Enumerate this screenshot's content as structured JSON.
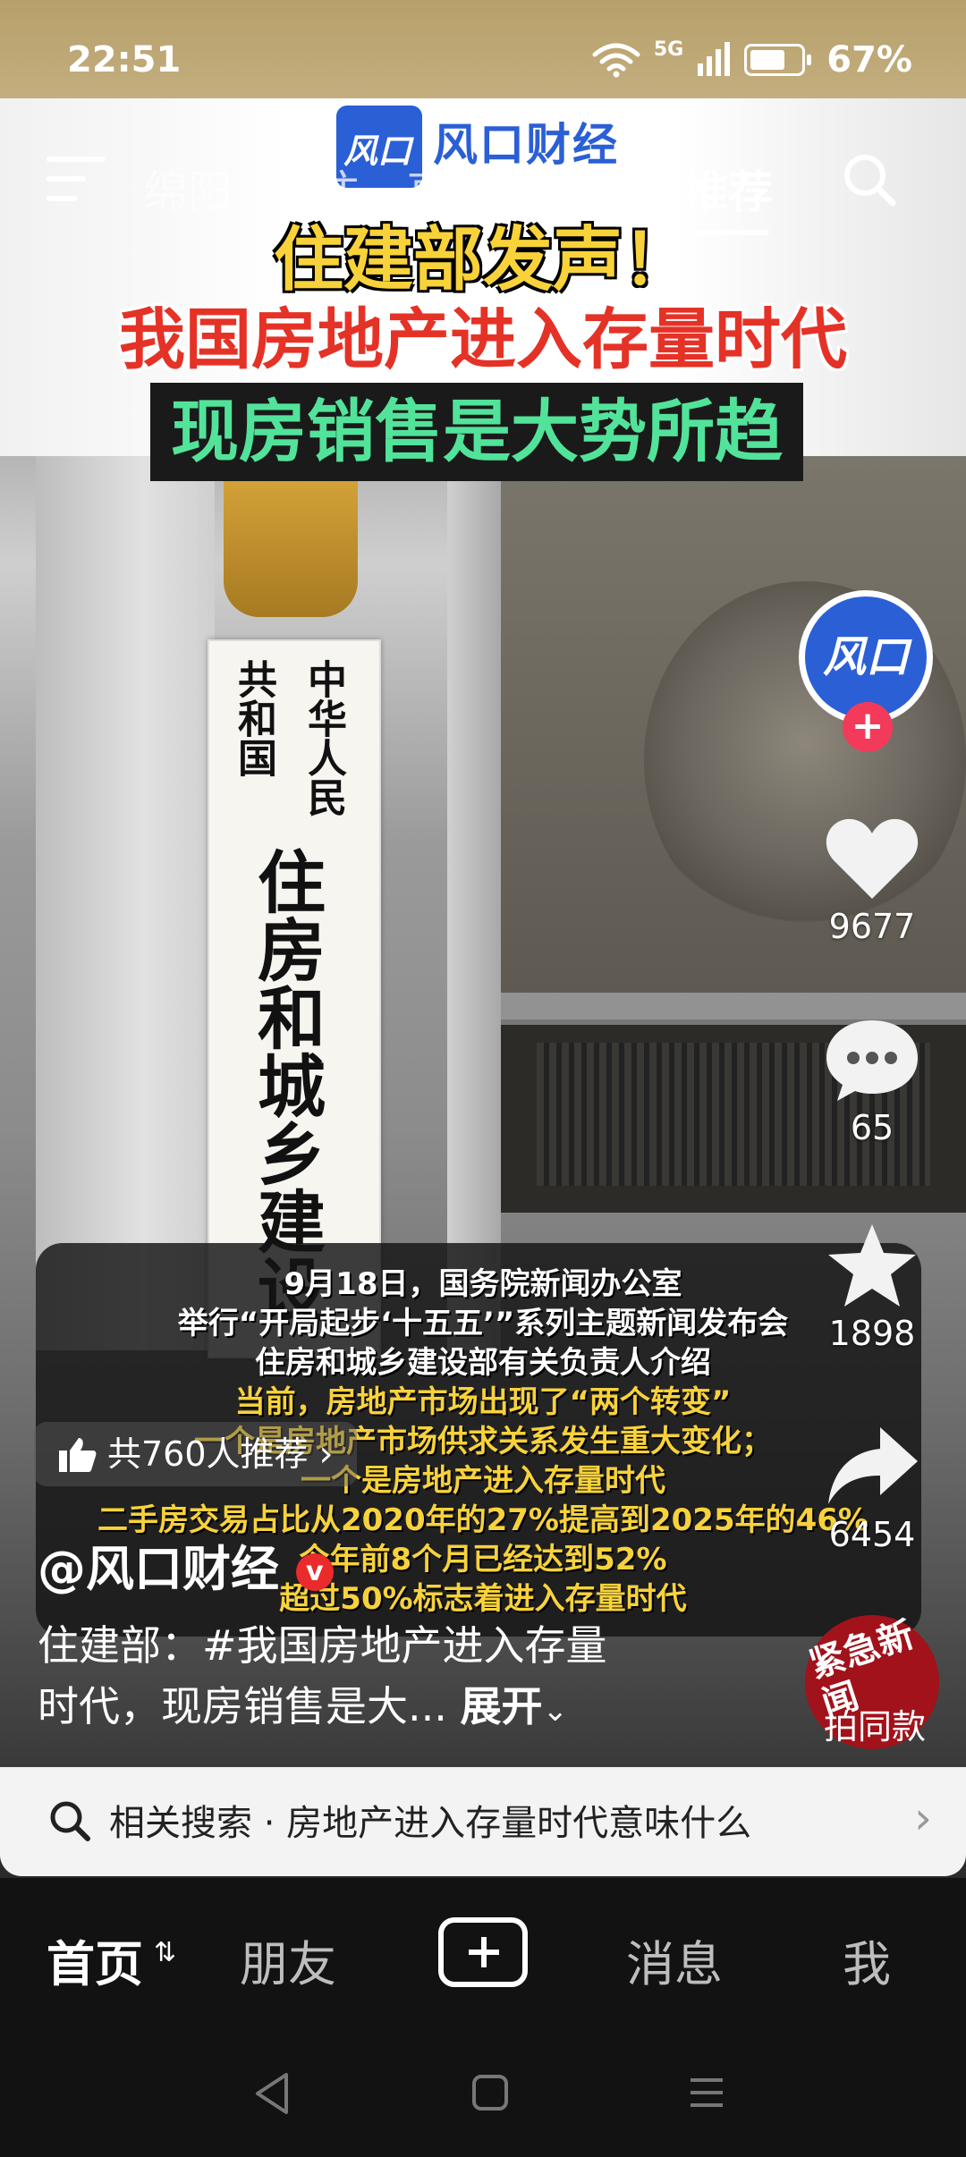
{
  "status_bar": {
    "time": "22:51",
    "network": "5G",
    "battery": "67%"
  },
  "top_nav": {
    "tabs": [
      "绵阳",
      "关注",
      "直播",
      "商城",
      "推荐"
    ],
    "active_tab": "推荐"
  },
  "video": {
    "logo_text": "风口财经",
    "logo_mark": "风口",
    "headline1": "住建部发声！",
    "headline2": "我国房地产进入存量时代",
    "headline3": "现房销售是大势所趋",
    "sign_small": [
      "共和国",
      "中华人民"
    ],
    "sign_big": "住房和城乡建设",
    "subtitles": [
      {
        "text": "9月18日，国务院新闻办公室",
        "color": "white"
      },
      {
        "text": "举行“开局起步‘十五五’”系列主题新闻发布会",
        "color": "white"
      },
      {
        "text": "住房和城乡建设部有关负责人介绍",
        "color": "white"
      },
      {
        "text": "当前，房地产市场出现了“两个转变”",
        "color": "yellow"
      },
      {
        "text": "一个是房地产市场供求关系发生重大变化；",
        "color": "yellow"
      },
      {
        "text": "一个是房地产进入存量时代",
        "color": "yellow"
      },
      {
        "text": "二手房交易占比从2020年的27%提高到2025年的46%",
        "color": "yellow"
      },
      {
        "text": "今年前8个月已经达到52%",
        "color": "yellow"
      },
      {
        "text": "超过50%标志着进入存量时代",
        "color": "yellow"
      }
    ]
  },
  "side_actions": {
    "avatar_text": "风口",
    "likes": "9677",
    "comments": "65",
    "favorites": "1898",
    "shares": "6454",
    "same_template_label": "拍同款",
    "same_template_seal": "紧急新闻"
  },
  "recommend": {
    "text": "共760人推荐"
  },
  "author": {
    "name": "@风口财经",
    "badge": "v"
  },
  "description": {
    "line1": "住建部：#我国房地产进入存量",
    "line2": "时代，现房销售是大...",
    "more": "展开"
  },
  "related_search": {
    "text": "相关搜索 · 房地产进入存量时代意味什么"
  },
  "bottom_nav": {
    "home": "首页",
    "friends": "朋友",
    "messages": "消息",
    "me": "我"
  },
  "colors": {
    "accent_blue": "#2a5fd6",
    "headline_yellow": "#f8d23a",
    "headline_red": "#e53227",
    "headline_green": "#52e39a",
    "follow_pink": "#f43a5a"
  }
}
